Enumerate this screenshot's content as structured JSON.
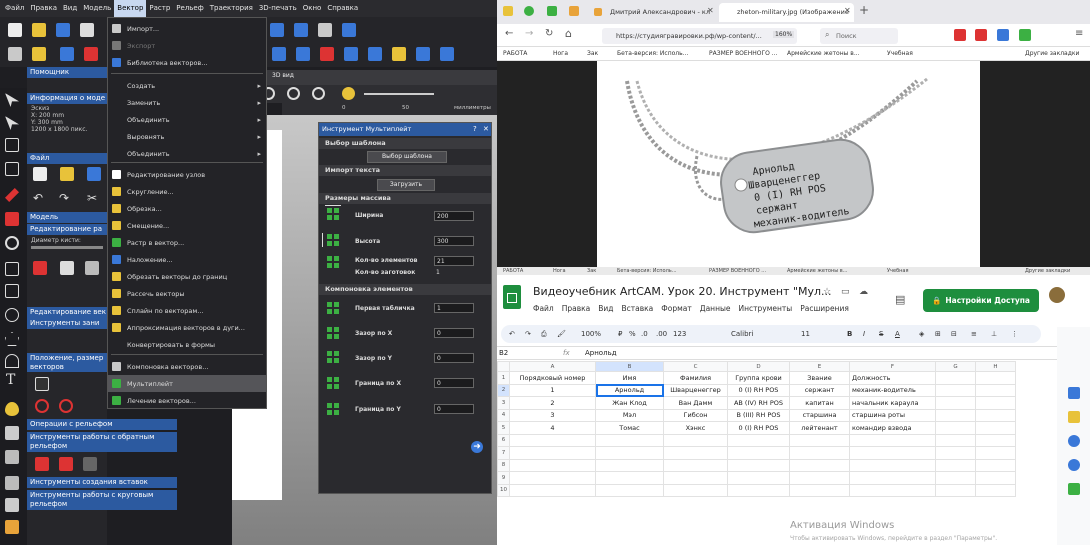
{
  "artcam": {
    "menubar": [
      "Файл",
      "Правка",
      "Вид",
      "Модель",
      "Вектор",
      "Растр",
      "Рельеф",
      "Траектория",
      "3D-печать",
      "Окно",
      "Справка"
    ],
    "active_menu": "Вектор",
    "helper": {
      "title": "Помощник",
      "model_info_title": "Информация о моде",
      "model_info": [
        "Эскиз",
        "X: 200 mm",
        "Y: 300 mm",
        "1200 x 1800 пикс."
      ],
      "file_title": "Файл",
      "model_title": "Модель",
      "edit_title": "Редактирование ра",
      "brush_label": "Диаметр кисти:",
      "vec_edit_title": "Редактирование век",
      "vec_tools_title": "Инструменты зани",
      "pos_title": "Положение, размер",
      "vectors_label": "векторов",
      "relief_ops": "Операции с рельефом",
      "reverse_relief": "Инструменты работы с обратным рельефом",
      "inserts": "Инструменты создания вставок",
      "round_relief": "Инструменты работы с круговым рельефом"
    },
    "view_tab": "3D вид",
    "ruler": {
      "mark0": "0",
      "mark50": "50",
      "unit": "миллиметры"
    },
    "vector_menu": [
      {
        "label": "Импорт...",
        "disabled": false,
        "arrow": false,
        "color": "#c9c9c9"
      },
      {
        "label": "Экспорт",
        "disabled": true,
        "arrow": false,
        "color": "#777777"
      },
      {
        "label": "Библиотека векторов...",
        "disabled": false,
        "arrow": false,
        "color": "#3a78d8"
      },
      {
        "label": "Создать",
        "disabled": false,
        "arrow": true,
        "color": ""
      },
      {
        "label": "Заменить",
        "disabled": false,
        "arrow": true,
        "color": ""
      },
      {
        "label": "Объединить",
        "disabled": false,
        "arrow": true,
        "color": ""
      },
      {
        "label": "Выровнять",
        "disabled": false,
        "arrow": true,
        "color": ""
      },
      {
        "label": "Объединить",
        "disabled": false,
        "arrow": true,
        "color": ""
      },
      {
        "label": "Редактирование узлов",
        "disabled": false,
        "arrow": false,
        "color": "#ffffff"
      },
      {
        "label": "Скругление...",
        "disabled": false,
        "arrow": false,
        "color": "#e8c23a"
      },
      {
        "label": "Обрезка...",
        "disabled": false,
        "arrow": false,
        "color": "#e8c23a"
      },
      {
        "label": "Смещение...",
        "disabled": false,
        "arrow": false,
        "color": "#e8c23a"
      },
      {
        "label": "Растр в вектор...",
        "disabled": false,
        "arrow": false,
        "color": "#3cb043"
      },
      {
        "label": "Наложение...",
        "disabled": false,
        "arrow": false,
        "color": "#3a78d8"
      },
      {
        "label": "Обрезать векторы до границ",
        "disabled": false,
        "arrow": false,
        "color": "#e8c23a"
      },
      {
        "label": "Рассечь векторы",
        "disabled": false,
        "arrow": false,
        "color": "#e8c23a"
      },
      {
        "label": "Сплайн по векторам...",
        "disabled": false,
        "arrow": false,
        "color": "#e8c23a"
      },
      {
        "label": "Аппроксимация векторов в дуги...",
        "disabled": false,
        "arrow": false,
        "color": "#e8c23a"
      },
      {
        "label": "Конвертировать в формы",
        "disabled": false,
        "arrow": false,
        "color": ""
      },
      {
        "label": "Компоновка векторов...",
        "disabled": false,
        "arrow": false,
        "color": "#c9c9c9"
      },
      {
        "label": "Мультиплейт",
        "disabled": false,
        "arrow": false,
        "color": "#3cb043"
      },
      {
        "label": "Лечение векторов...",
        "disabled": false,
        "arrow": false,
        "color": "#3cb043"
      }
    ],
    "highlighted_menu_item": "Мультиплейт",
    "multiplate": {
      "title": "Инструмент Мультиплейт",
      "help": "?",
      "close": "✕",
      "template_section": "Выбор шаблона",
      "template_button": "Выбор шаблона",
      "import_section": "Импорт текста",
      "import_button": "Загрузить",
      "sizes_section": "Размеры массива",
      "width_label": "Ширина",
      "width_value": "200",
      "height_label": "Высота",
      "height_value": "300",
      "elements_label": "Кол-во элементов",
      "elements_value": "21",
      "blanks_label": "Кол-во заготовок",
      "blanks_value": "1",
      "layout_section": "Компоновка элементов",
      "first_table_label": "Первая табличка",
      "first_table_value": "1",
      "gap_x_label": "Зазор по X",
      "gap_x_value": "0",
      "gap_y_label": "Зазор по Y",
      "gap_y_value": "0",
      "border_x_label": "Граница по X",
      "border_x_value": "0",
      "border_y_label": "Граница по Y",
      "border_y_value": "0"
    }
  },
  "browser": {
    "tabs": [
      {
        "title": "Дмитрий Александрович - кл",
        "active": false
      },
      {
        "title": "zheton-military.jpg (Изображение",
        "active": true
      }
    ],
    "new_tab": "+",
    "url": "https://студиягравировки.рф/wp-content/...",
    "zoom": "160%",
    "search_placeholder": "Поиск",
    "bookmarks": [
      "РАБОТА",
      "Нога",
      "Зак",
      "Бета-версия: Исполь...",
      "РАЗМЕР ВОЕННОГО ...",
      "Армейские жетоны в...",
      "Учебная"
    ],
    "other_bookmarks": "Другие закладки",
    "tag_text": [
      "Арнольд",
      "Шварценеггер",
      "0 (I)  RH POS",
      "сержант",
      "механик-водитель"
    ]
  },
  "sheets": {
    "strip": [
      "РАБОТА",
      "Нога",
      "Зак",
      "Бета-версия: Исполь...",
      "РАЗМЕР ВОЕННОГО ...",
      "Армейские жетоны в...",
      "Учебная",
      "Другие закладки"
    ],
    "doc_title": "Видеоучебник ArtCAM. Урок 20. Инструмент \"Мул...",
    "menu": [
      "Файл",
      "Правка",
      "Вид",
      "Вставка",
      "Формат",
      "Данные",
      "Инструменты",
      "Расширения"
    ],
    "share_button": "Настройки Доступа",
    "toolbar": {
      "zoom": "100%",
      "currency": "₽",
      "percent": "%",
      "dec1": ".0",
      "dec2": ".00",
      "fmt": "123",
      "font": "Calibri",
      "size": "11",
      "bold": "B",
      "italic": "I",
      "strike": "S",
      "color": "A"
    },
    "cell_ref": "B2",
    "fx": "fx",
    "formula_value": "Арнольд",
    "columns": [
      "A",
      "B",
      "C",
      "D",
      "E",
      "F",
      "G",
      "H"
    ],
    "rows": [
      [
        "1",
        "Порядковый номер",
        "Имя",
        "Фамилия",
        "Группа крови",
        "Звание",
        "Должность",
        "",
        ""
      ],
      [
        "2",
        "1",
        "Арнольд",
        "Шварценеггер",
        "0 (I)  RH POS",
        "сержант",
        "механик-водитель",
        "",
        ""
      ],
      [
        "3",
        "2",
        "Жан Клод",
        "Ван Дамм",
        "AB (IV)  RH POS",
        "капитан",
        "начальник караула",
        "",
        ""
      ],
      [
        "4",
        "3",
        "Мэл",
        "Гибсон",
        "B (III)  RH POS",
        "старшина",
        "старшина роты",
        "",
        ""
      ],
      [
        "5",
        "4",
        "Томас",
        "Хэнкс",
        "0 (I)  RH POS",
        "лейтенант",
        "командир взвода",
        "",
        ""
      ],
      [
        "6",
        "",
        "",
        "",
        "",
        "",
        "",
        "",
        ""
      ],
      [
        "7",
        "",
        "",
        "",
        "",
        "",
        "",
        "",
        ""
      ],
      [
        "8",
        "",
        "",
        "",
        "",
        "",
        "",
        "",
        ""
      ],
      [
        "9",
        "",
        "",
        "",
        "",
        "",
        "",
        "",
        ""
      ],
      [
        "10",
        "",
        "",
        "",
        "",
        "",
        "",
        "",
        ""
      ]
    ],
    "activation_title": "Активация Windows",
    "activation_text": "Чтобы активировать Windows, перейдите в раздел \"Параметры\"."
  }
}
